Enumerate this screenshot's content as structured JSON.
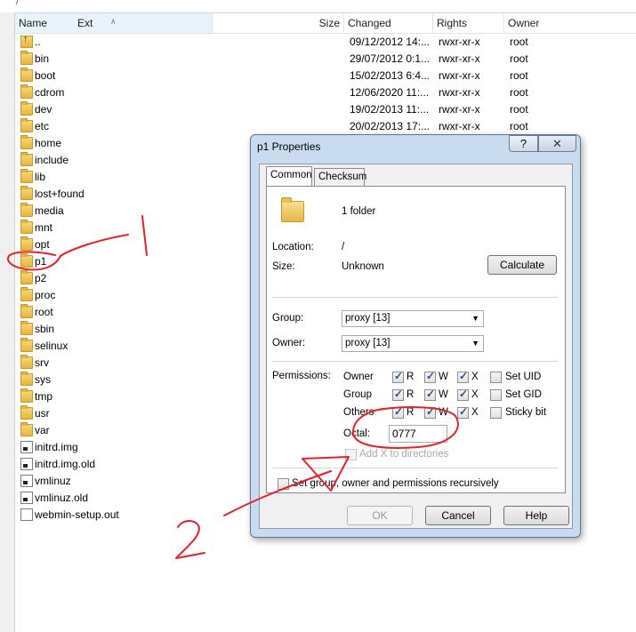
{
  "path": "/",
  "columns": {
    "name": "Name",
    "ext": "Ext",
    "size": "Size",
    "changed": "Changed",
    "rights": "Rights",
    "owner": "Owner"
  },
  "rows": [
    {
      "icon": "parent-dir-icon",
      "name": "..",
      "changed": "09/12/2012 14:...",
      "rights": "rwxr-xr-x",
      "owner": "root"
    },
    {
      "icon": "folder-icon",
      "name": "bin",
      "changed": "29/07/2012 0:1...",
      "rights": "rwxr-xr-x",
      "owner": "root"
    },
    {
      "icon": "folder-icon",
      "name": "boot",
      "changed": "15/02/2013 6:4...",
      "rights": "rwxr-xr-x",
      "owner": "root"
    },
    {
      "icon": "folder-icon",
      "name": "cdrom",
      "changed": "12/06/2020 11:...",
      "rights": "rwxr-xr-x",
      "owner": "root"
    },
    {
      "icon": "folder-icon",
      "name": "dev",
      "changed": "19/02/2013 11:...",
      "rights": "rwxr-xr-x",
      "owner": "root"
    },
    {
      "icon": "folder-icon",
      "name": "etc",
      "changed": "20/02/2013 17:...",
      "rights": "rwxr-xr-x",
      "owner": "root"
    },
    {
      "icon": "folder-icon",
      "name": "home",
      "changed": "",
      "rights": "",
      "owner": ""
    },
    {
      "icon": "folder-icon",
      "name": "include",
      "changed": "",
      "rights": "",
      "owner": ""
    },
    {
      "icon": "folder-icon",
      "name": "lib",
      "changed": "",
      "rights": "",
      "owner": ""
    },
    {
      "icon": "folder-icon",
      "name": "lost+found",
      "changed": "",
      "rights": "",
      "owner": ""
    },
    {
      "icon": "folder-icon",
      "name": "media",
      "changed": "",
      "rights": "",
      "owner": ""
    },
    {
      "icon": "folder-icon",
      "name": "mnt",
      "changed": "",
      "rights": "",
      "owner": ""
    },
    {
      "icon": "folder-icon",
      "name": "opt",
      "changed": "",
      "rights": "",
      "owner": ""
    },
    {
      "icon": "folder-icon",
      "name": "p1",
      "changed": "",
      "rights": "",
      "owner": ""
    },
    {
      "icon": "folder-icon",
      "name": "p2",
      "changed": "",
      "rights": "",
      "owner": ""
    },
    {
      "icon": "folder-icon",
      "name": "proc",
      "changed": "",
      "rights": "",
      "owner": ""
    },
    {
      "icon": "folder-icon",
      "name": "root",
      "changed": "",
      "rights": "",
      "owner": ""
    },
    {
      "icon": "folder-icon",
      "name": "sbin",
      "changed": "",
      "rights": "",
      "owner": ""
    },
    {
      "icon": "folder-icon",
      "name": "selinux",
      "changed": "",
      "rights": "",
      "owner": ""
    },
    {
      "icon": "folder-icon",
      "name": "srv",
      "changed": "",
      "rights": "",
      "owner": ""
    },
    {
      "icon": "folder-icon",
      "name": "sys",
      "changed": "",
      "rights": "",
      "owner": ""
    },
    {
      "icon": "folder-icon",
      "name": "tmp",
      "changed": "",
      "rights": "",
      "owner": ""
    },
    {
      "icon": "folder-icon",
      "name": "usr",
      "changed": "",
      "rights": "",
      "owner": ""
    },
    {
      "icon": "folder-icon",
      "name": "var",
      "changed": "",
      "rights": "",
      "owner": ""
    },
    {
      "icon": "exec-file-icon",
      "name": "initrd.img",
      "changed": "",
      "rights": "",
      "owner": ""
    },
    {
      "icon": "exec-file-icon",
      "name": "initrd.img.old",
      "changed": "",
      "rights": "",
      "owner": ""
    },
    {
      "icon": "exec-file-icon",
      "name": "vmlinuz",
      "changed": "",
      "rights": "",
      "owner": ""
    },
    {
      "icon": "exec-file-icon",
      "name": "vmlinuz.old",
      "changed": "",
      "rights": "",
      "owner": ""
    },
    {
      "icon": "file-icon",
      "name": "webmin-setup.out",
      "changed": "",
      "rights": "",
      "owner": ""
    }
  ],
  "dialog": {
    "title": "p1 Properties",
    "help_glyph": "?",
    "close_glyph": "✕",
    "tabs": [
      "Common",
      "Checksum"
    ],
    "summary": "1 folder",
    "location_label": "Location:",
    "location_value": "/",
    "size_label": "Size:",
    "size_value": "Unknown",
    "calculate_label": "Calculate",
    "group_label": "Group:",
    "group_value": "proxy [13]",
    "owner_label": "Owner:",
    "owner_value": "proxy [13]",
    "permissions_label": "Permissions:",
    "perm_rows": [
      {
        "label": "Owner",
        "r": "R",
        "w": "W",
        "x": "X",
        "extra": "Set UID"
      },
      {
        "label": "Group",
        "r": "R",
        "w": "W",
        "x": "X",
        "extra": "Set GID"
      },
      {
        "label": "Others",
        "r": "R",
        "w": "W",
        "x": "X",
        "extra": "Sticky bit"
      }
    ],
    "octal_label": "Octal:",
    "octal_value": "0777",
    "add_x_label": "Add X to directories",
    "recursive_label": "Set group, owner and permissions recursively",
    "ok_label": "OK",
    "cancel_label": "Cancel",
    "help_label": "Help"
  },
  "annotations": {
    "mark_1": "1",
    "mark_2": "2",
    "color": "#e8202a"
  }
}
